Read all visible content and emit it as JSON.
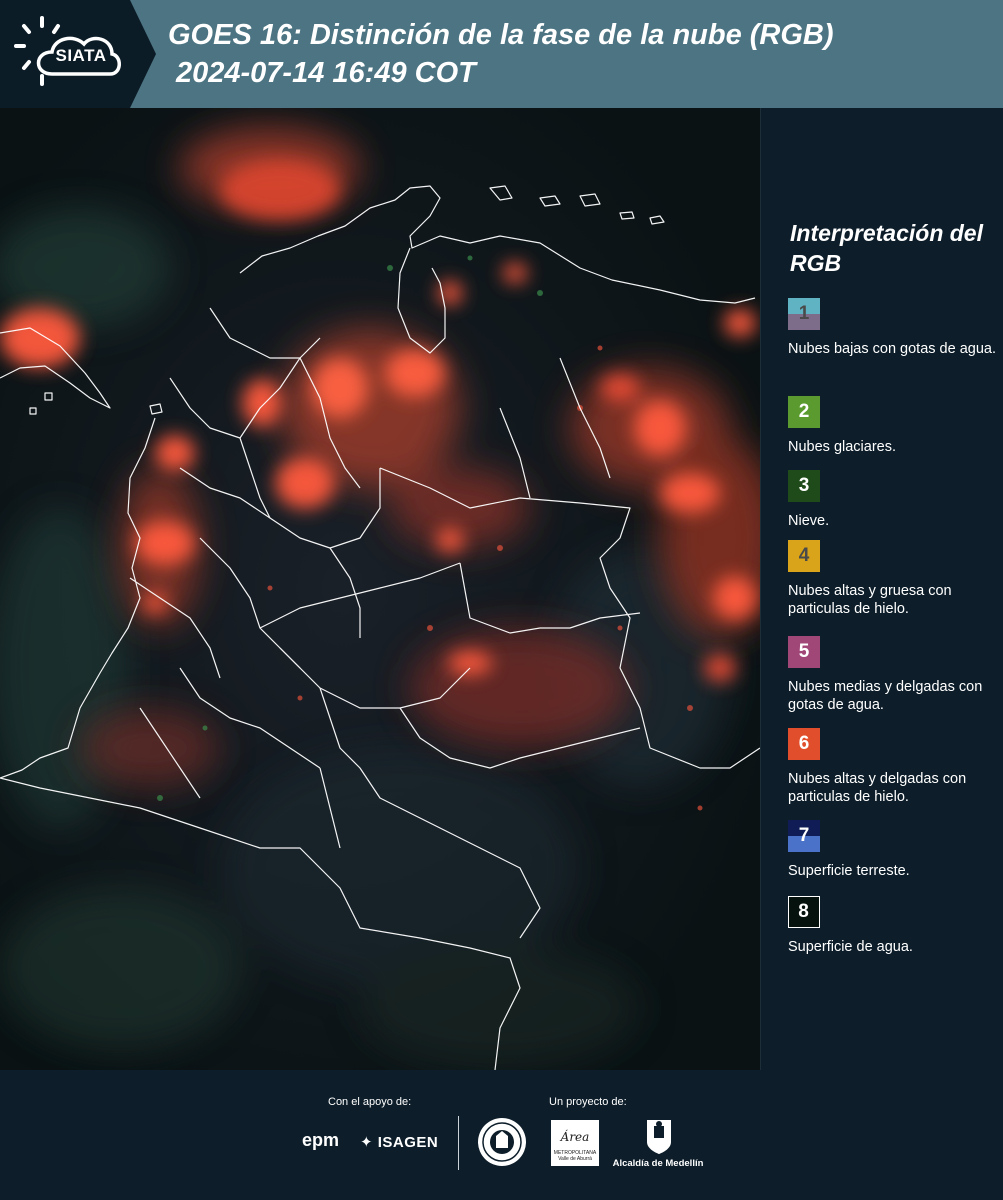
{
  "header": {
    "logo_text": "SIATA",
    "title": "GOES 16: Distinción de la fase de la nube (RGB)",
    "timestamp": "2024-07-14 16:49 COT"
  },
  "legend": {
    "title": "Interpretación del RGB",
    "items": [
      {
        "number": "1",
        "label": "Nubes bajas con gotas de agua.",
        "colors": [
          "#5fb3c3",
          "#7d6c8a"
        ],
        "num_color": "#4a4a4a"
      },
      {
        "number": "2",
        "label": "Nubes glaciares.",
        "colors": [
          "#5a9a2e",
          "#5a9a2e"
        ],
        "num_color": "#ffffff"
      },
      {
        "number": "3",
        "label": "Nieve.",
        "colors": [
          "#1f4a1a",
          "#1f4a1a"
        ],
        "num_color": "#ffffff"
      },
      {
        "number": "4",
        "label": "Nubes altas y gruesa con particulas de hielo.",
        "colors": [
          "#d9a419",
          "#d9a419"
        ],
        "num_color": "#4a4a4a"
      },
      {
        "number": "5",
        "label": "Nubes medias y delgadas con gotas de agua.",
        "colors": [
          "#a04778",
          "#a04778"
        ],
        "num_color": "#ffffff"
      },
      {
        "number": "6",
        "label": "Nubes altas y delgadas con particulas de hielo.",
        "colors": [
          "#e04e2c",
          "#e04e2c"
        ],
        "num_color": "#ffffff"
      },
      {
        "number": "7",
        "label": "Superficie terreste.",
        "colors": [
          "#0f1c55",
          "#4a72c8"
        ],
        "num_color": "#ffffff"
      },
      {
        "number": "8",
        "label": "Superficie de agua.",
        "colors": [
          "#06120d",
          "#06120d"
        ],
        "num_color": "#ffffff"
      }
    ]
  },
  "footer": {
    "support_label": "Con el apoyo de:",
    "project_label": "Un proyecto de:",
    "sponsor_1": "epm",
    "sponsor_2": "ISAGEN",
    "partner_1": "Área",
    "partner_1_sub": "METROPOLITANA Valle de Aburrá",
    "partner_2": "Alcaldía de Medellín"
  },
  "colors": {
    "header_bg": "#4c7482",
    "panel_bg": "#0d1e2a",
    "cloud_ice": "#ff5a3c",
    "boundary": "#ffffff"
  }
}
